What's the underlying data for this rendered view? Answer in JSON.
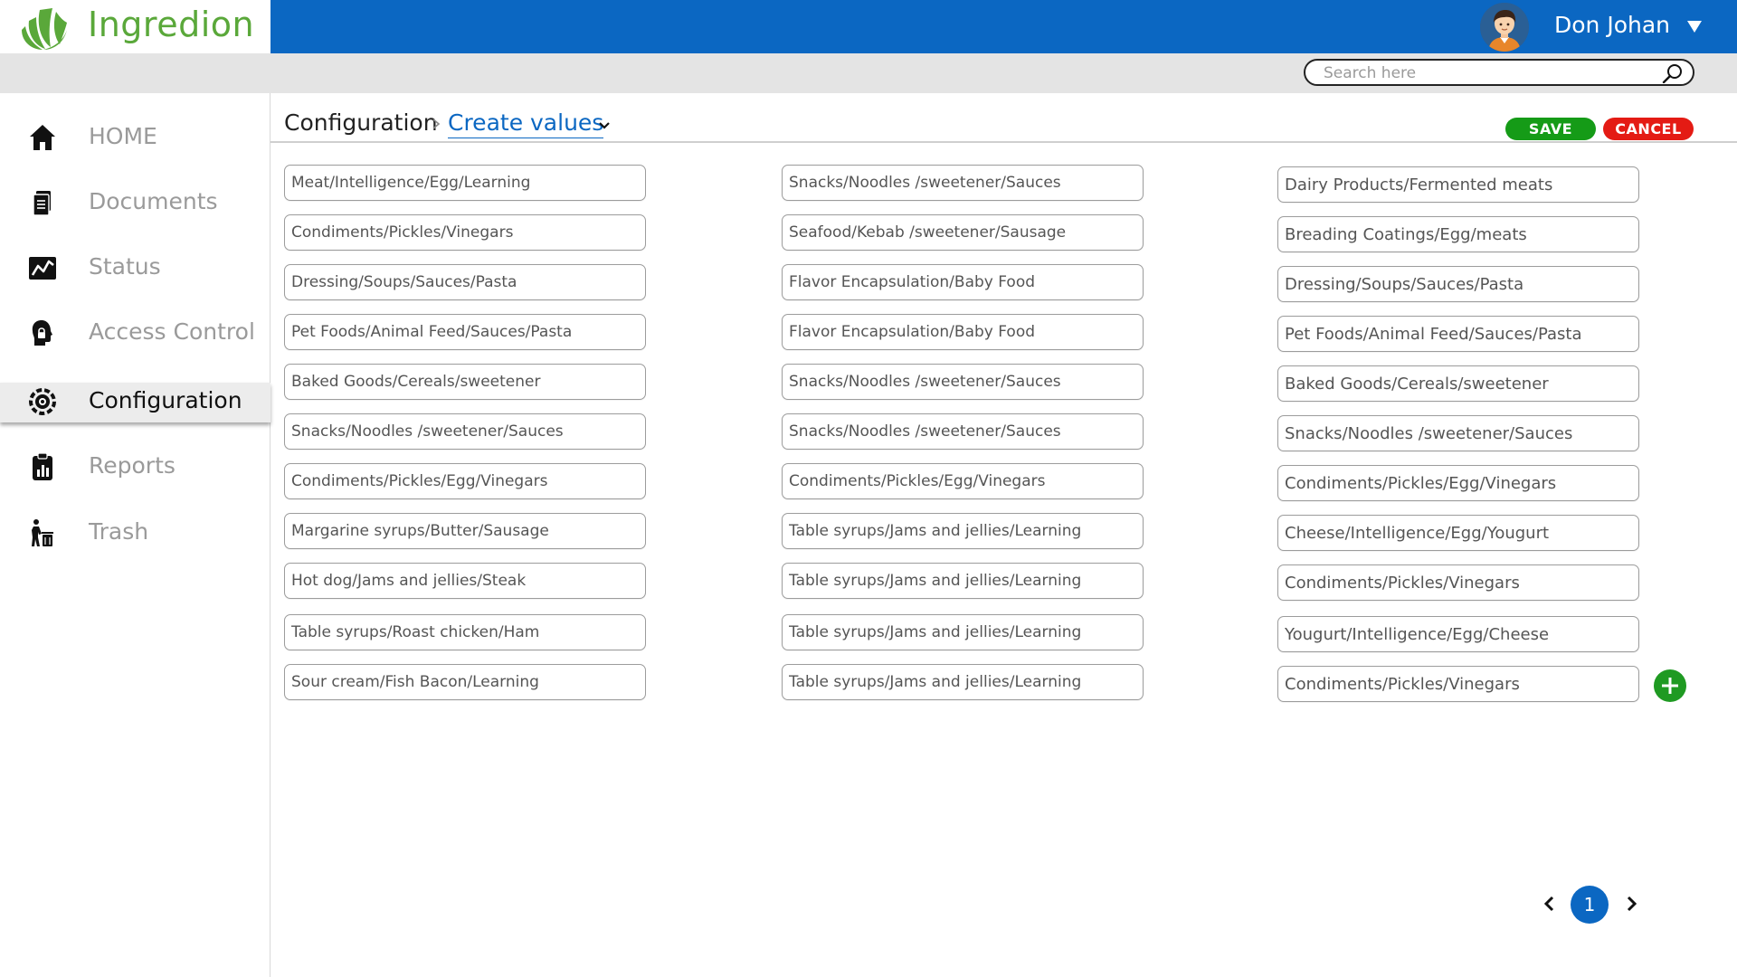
{
  "app": {
    "name": "Ingredion",
    "brand_color": "#5aa83a",
    "header_color": "#0b67c2"
  },
  "user": {
    "name": "Don Johan",
    "menu_icon": "caret-down-icon"
  },
  "search": {
    "placeholder": "Search here",
    "value": ""
  },
  "sidebar": {
    "items": [
      {
        "label": "HOME",
        "icon": "home-icon",
        "active": false
      },
      {
        "label": "Documents",
        "icon": "documents-icon",
        "active": false
      },
      {
        "label": "Status",
        "icon": "status-chart-icon",
        "active": false
      },
      {
        "label": "Access Control",
        "icon": "access-control-icon",
        "active": false
      },
      {
        "label": "Configuration",
        "icon": "configuration-icon",
        "active": true
      },
      {
        "label": "Reports",
        "icon": "reports-icon",
        "active": false
      },
      {
        "label": "Trash",
        "icon": "trash-icon",
        "active": false
      }
    ]
  },
  "breadcrumb": {
    "root": "Configuration",
    "current": "Create values"
  },
  "actions": {
    "save_label": "SAVE",
    "save_color": "#159b17",
    "cancel_label": "CANCEL",
    "cancel_color": "#e41b14"
  },
  "values": {
    "column1": [
      "Meat/Intelligence/Egg/Learning",
      "Condiments/Pickles/Vinegars",
      "Dressing/Soups/Sauces/Pasta",
      "Pet Foods/Animal Feed/Sauces/Pasta",
      "Baked Goods/Cereals/sweetener",
      "Snacks/Noodles /sweetener/Sauces",
      "Condiments/Pickles/Egg/Vinegars",
      "Margarine syrups/Butter/Sausage",
      "Hot dog/Jams and jellies/Steak",
      "Table syrups/Roast chicken/Ham",
      "Sour cream/Fish Bacon/Learning"
    ],
    "column2": [
      "Snacks/Noodles /sweetener/Sauces",
      "Seafood/Kebab /sweetener/Sausage",
      "Flavor Encapsulation/Baby Food",
      "Flavor Encapsulation/Baby Food",
      "Snacks/Noodles /sweetener/Sauces",
      "Snacks/Noodles /sweetener/Sauces",
      "Condiments/Pickles/Egg/Vinegars",
      "Table syrups/Jams and jellies/Learning",
      "Table syrups/Jams and jellies/Learning",
      "Table syrups/Jams and jellies/Learning",
      "Table syrups/Jams and jellies/Learning"
    ],
    "column3": [
      "Dairy Products/Fermented meats",
      "Breading Coatings/Egg/meats",
      "Dressing/Soups/Sauces/Pasta",
      "Pet Foods/Animal Feed/Sauces/Pasta",
      "Baked Goods/Cereals/sweetener",
      "Snacks/Noodles /sweetener/Sauces",
      "Condiments/Pickles/Egg/Vinegars",
      "Cheese/Intelligence/Egg/Yougurt",
      "Condiments/Pickles/Vinegars",
      "Yougurt/Intelligence/Egg/Cheese",
      "Condiments/Pickles/Vinegars"
    ]
  },
  "add_button": {
    "icon": "plus-icon",
    "color": "#1f9a22"
  },
  "pagination": {
    "current_page": "1",
    "prev_icon": "chevron-left-icon",
    "next_icon": "chevron-right-icon"
  }
}
